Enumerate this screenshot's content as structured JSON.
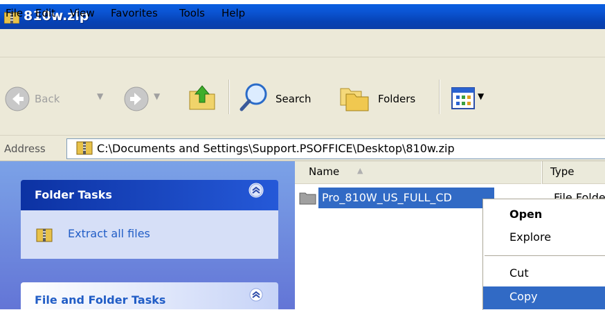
{
  "window": {
    "title": "810w.zip"
  },
  "menu": [
    "File",
    "Edit",
    "View",
    "Favorites",
    "Tools",
    "Help"
  ],
  "toolbar": {
    "back": "Back",
    "search": "Search",
    "folders": "Folders"
  },
  "address": {
    "label": "Address",
    "path": "C:\\Documents and Settings\\Support.PSOFFICE\\Desktop\\810w.zip"
  },
  "taskpane": {
    "folder_tasks": {
      "title": "Folder Tasks",
      "items": [
        "Extract all files"
      ]
    },
    "file_and_folder_tasks": {
      "title": "File and Folder Tasks"
    }
  },
  "filelist": {
    "columns": [
      "Name",
      "Type"
    ],
    "rows": [
      {
        "name": "Pro_810W_US_FULL_CD",
        "type": "File Folder"
      }
    ]
  },
  "context_menu": {
    "items": [
      "Open",
      "Explore",
      "Cut",
      "Copy"
    ],
    "bold_item": "Open",
    "highlighted_item": "Copy"
  },
  "colors": {
    "title_bar": "#0b55d4",
    "selection": "#316ac5",
    "chrome": "#ece9d8",
    "task_pane": "#6f8ee0"
  }
}
